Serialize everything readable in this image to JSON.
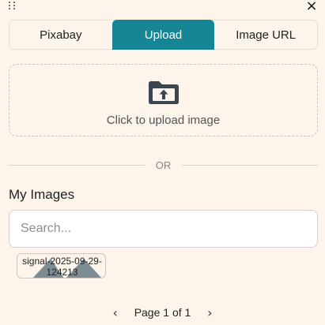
{
  "header": {
    "close_icon": "×"
  },
  "tabs": [
    {
      "label": "Pixabay",
      "active": false
    },
    {
      "label": "Upload",
      "active": true
    },
    {
      "label": "Image URL",
      "active": false
    }
  ],
  "colors": {
    "accent": "#168595",
    "background": "#fdf5ec",
    "icon": "#3a4651"
  },
  "upload": {
    "icon": "folder-upload-icon",
    "text": "Click to upload image"
  },
  "divider": {
    "text": "OR"
  },
  "my_images": {
    "title": "My Images",
    "search_placeholder": "Search...",
    "items": [
      {
        "label": "signal-2025-09-29-124213"
      }
    ]
  },
  "pagination": {
    "label": "Page 1 of 1",
    "prev": "‹",
    "next": "›"
  }
}
